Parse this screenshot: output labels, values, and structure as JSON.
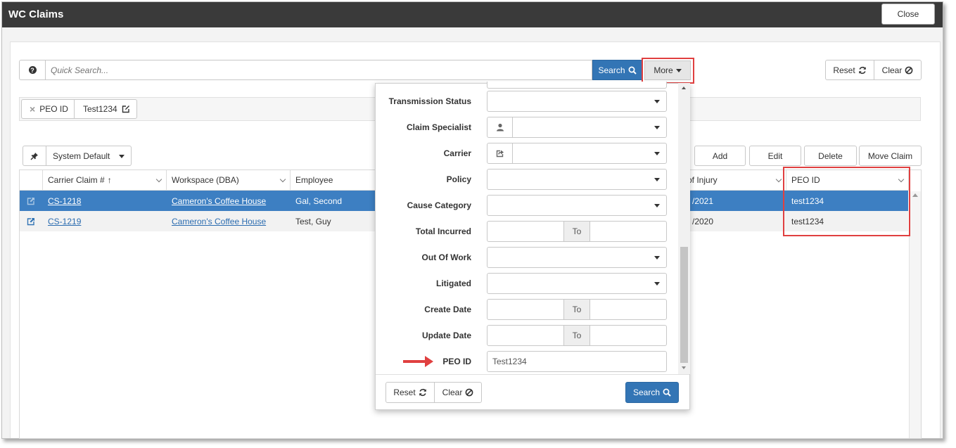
{
  "window": {
    "title": "WC Claims",
    "close_label": "Close"
  },
  "search": {
    "placeholder": "Quick Search...",
    "search_label": "Search",
    "more_label": "More",
    "reset_label": "Reset",
    "clear_label": "Clear"
  },
  "chips": [
    {
      "label": "PEO ID",
      "value": "Test1234"
    }
  ],
  "view": {
    "selected": "System Default"
  },
  "actions": {
    "add": "Add",
    "edit": "Edit",
    "delete": "Delete",
    "move": "Move Claim"
  },
  "columns": {
    "carrier_claim": "Carrier Claim #",
    "workspace": "Workspace (DBA)",
    "employee": "Employee",
    "date_of_injury": "of Injury",
    "peo_id": "PEO ID"
  },
  "rows": [
    {
      "claim": "CS-1218",
      "workspace": "Cameron's Coffee House",
      "employee": "Gal, Second",
      "date": "/2021",
      "peo": "test1234"
    },
    {
      "claim": "CS-1219",
      "workspace": "Cameron's Coffee House",
      "employee": "Test, Guy",
      "date": "/2020",
      "peo": "test1234"
    }
  ],
  "filters": {
    "transmission_status": "Transmission Status",
    "claim_specialist": "Claim Specialist",
    "carrier": "Carrier",
    "policy": "Policy",
    "cause_category": "Cause Category",
    "total_incurred": "Total Incurred",
    "out_of_work": "Out Of Work",
    "litigated": "Litigated",
    "create_date": "Create Date",
    "update_date": "Update Date",
    "peo_id": "PEO ID",
    "peo_id_value": "Test1234",
    "to_label": "To"
  },
  "dropdown_footer": {
    "reset_label": "Reset",
    "clear_label": "Clear",
    "search_label": "Search"
  },
  "colors": {
    "title_bar": "#3a3a3a",
    "primary": "#3375b5",
    "selected_row": "#3d7fc2",
    "highlight": "#e04040"
  }
}
